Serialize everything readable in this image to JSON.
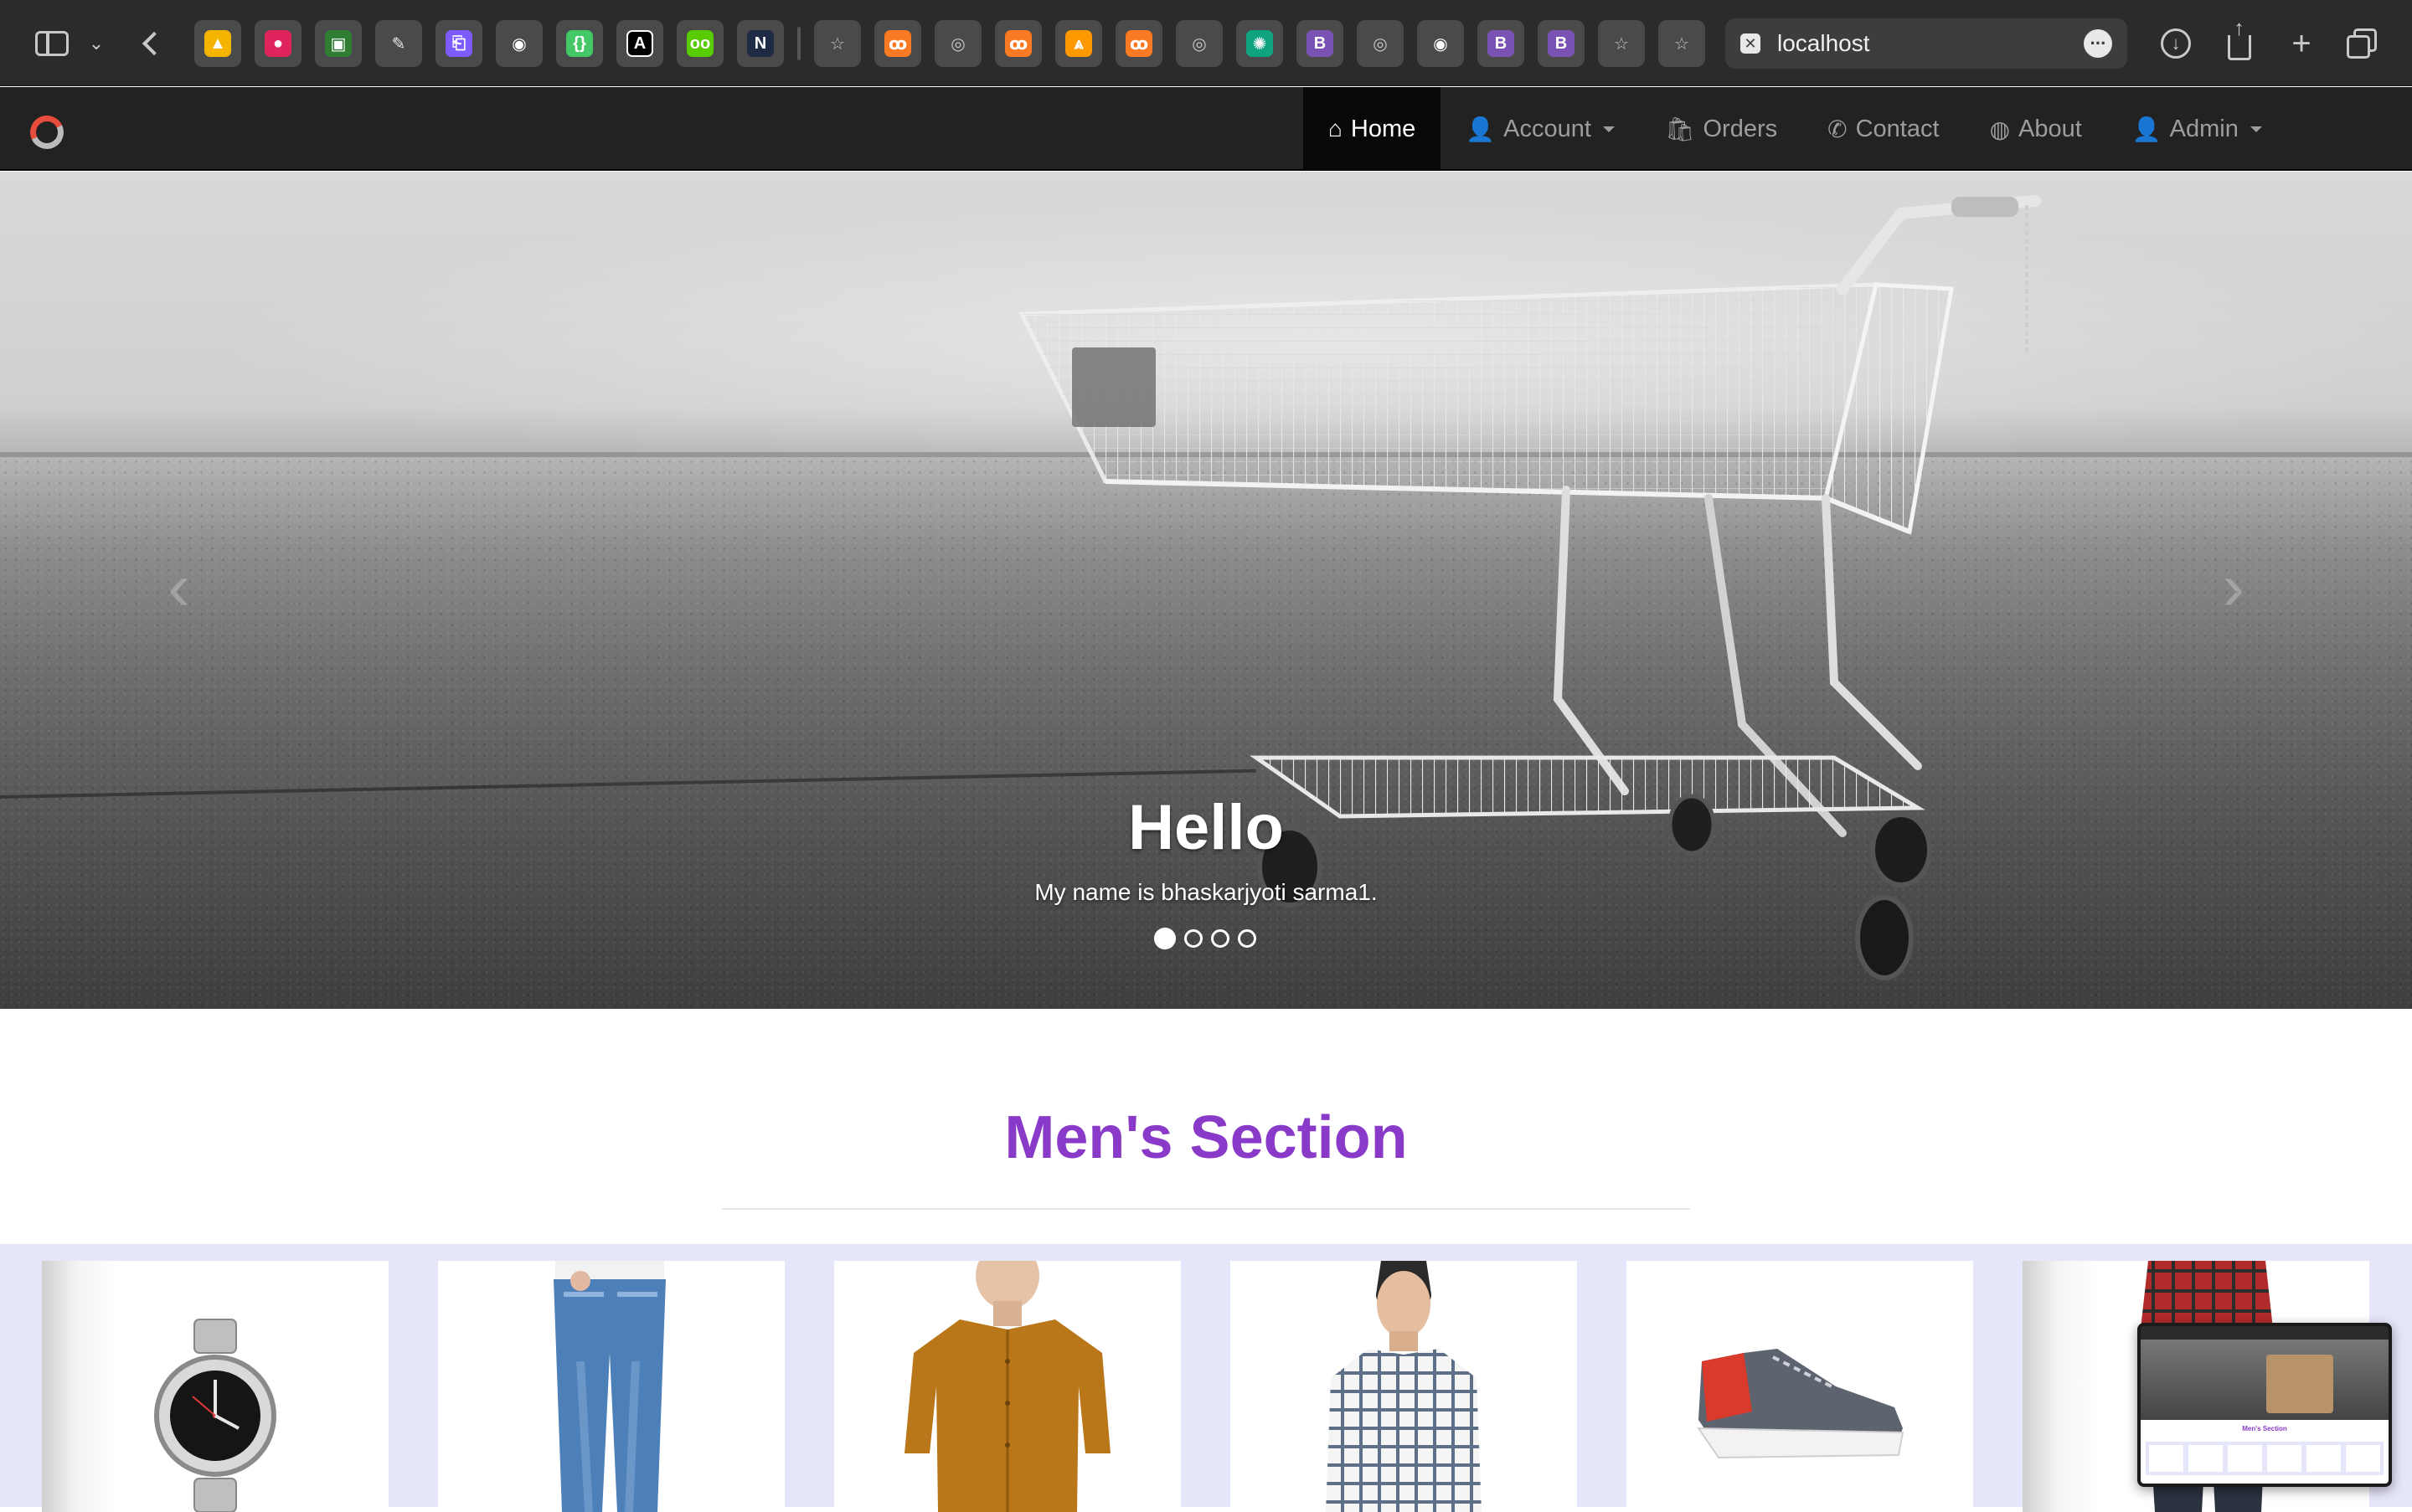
{
  "browser": {
    "url": "localhost",
    "toolbar_icons": [
      "sidebar-icon",
      "chevron-down-icon",
      "back-icon",
      "download-icon",
      "share-icon",
      "new-tab-icon",
      "tab-overview-icon"
    ],
    "favorites": [
      {
        "name": "google-drive",
        "glyph": "▲",
        "color": "#f4b400"
      },
      {
        "name": "red-circle",
        "glyph": "●",
        "color": "#e0245e"
      },
      {
        "name": "google-classroom",
        "glyph": "▣",
        "color": "#2e7d32"
      },
      {
        "name": "quill",
        "glyph": "✎",
        "color": "#e8e8e8"
      },
      {
        "name": "purple-clip",
        "glyph": "⎗",
        "color": "#7c5cff"
      },
      {
        "name": "github",
        "glyph": "◉",
        "color": "#ffffff"
      },
      {
        "name": "green-brackets",
        "glyph": "{}",
        "color": "#44c767"
      },
      {
        "name": "nextjs",
        "glyph": "A",
        "color": "#000000"
      },
      {
        "name": "duolingo",
        "glyph": "oo",
        "color": "#58cc02"
      },
      {
        "name": "notion",
        "glyph": "N",
        "color": "#1f2a44"
      },
      {
        "name": "star-1",
        "glyph": "☆",
        "color": "#c8c8c8"
      },
      {
        "name": "xampp-1",
        "glyph": "ꝏ",
        "color": "#fb7a24"
      },
      {
        "name": "compass-1",
        "glyph": "◎",
        "color": "#c8c8c8"
      },
      {
        "name": "xampp-2",
        "glyph": "ꝏ",
        "color": "#fb7a24"
      },
      {
        "name": "aws",
        "glyph": "⩓",
        "color": "#ff9900"
      },
      {
        "name": "xampp-3",
        "glyph": "ꝏ",
        "color": "#fb7a24"
      },
      {
        "name": "compass-2",
        "glyph": "◎",
        "color": "#c8c8c8"
      },
      {
        "name": "chatgpt",
        "glyph": "✺",
        "color": "#10a37f"
      },
      {
        "name": "bootstrap-1",
        "glyph": "B",
        "color": "#7952b3"
      },
      {
        "name": "compass-3",
        "glyph": "◎",
        "color": "#c8c8c8"
      },
      {
        "name": "github-2",
        "glyph": "◉",
        "color": "#ffffff"
      },
      {
        "name": "bootstrap-2",
        "glyph": "B",
        "color": "#7952b3"
      },
      {
        "name": "bootstrap-3",
        "glyph": "B",
        "color": "#7952b3"
      },
      {
        "name": "star-2",
        "glyph": "☆",
        "color": "#c8c8c8"
      },
      {
        "name": "star-3",
        "glyph": "☆",
        "color": "#c8c8c8"
      }
    ]
  },
  "navbar": {
    "brand_icon": "brand-logo-icon",
    "items": [
      {
        "label": "Home",
        "icon": "⌂",
        "icon_name": "home-icon",
        "active": true,
        "dropdown": false
      },
      {
        "label": "Account",
        "icon": "👤",
        "icon_name": "user-icon",
        "active": false,
        "dropdown": true
      },
      {
        "label": "Orders",
        "icon": "🛍",
        "icon_name": "shopping-bag-icon",
        "active": false,
        "dropdown": false
      },
      {
        "label": "Contact",
        "icon": "✆",
        "icon_name": "phone-icon",
        "active": false,
        "dropdown": false
      },
      {
        "label": "About",
        "icon": "◍",
        "icon_name": "globe-icon",
        "active": false,
        "dropdown": false
      },
      {
        "label": "Admin",
        "icon": "👤",
        "icon_name": "user-icon",
        "active": false,
        "dropdown": true
      }
    ],
    "colors": {
      "background": "#222222",
      "active_background": "#080808",
      "text": "#9d9d9d",
      "active_text": "#ffffff"
    }
  },
  "hero": {
    "title": "Hello",
    "subtitle": "My name is bhaskarjyoti sarma1.",
    "slide_count": 4,
    "active_slide": 0,
    "image": "shopping-cart-on-road-bw"
  },
  "section": {
    "title": "Men's Section",
    "title_color": "#8a3ac8",
    "band_color": "#e6e6fa"
  },
  "products": [
    {
      "name": "wristwatch",
      "image": "watch"
    },
    {
      "name": "blue-jeans",
      "image": "jeans"
    },
    {
      "name": "mustard-shirt",
      "image": "shirt"
    },
    {
      "name": "checked-shirt",
      "image": "checked-shirt"
    },
    {
      "name": "sneaker",
      "image": "shoe"
    },
    {
      "name": "plaid-shirt-jeans",
      "image": "outfit"
    }
  ],
  "preview": {
    "title": "Men's Section"
  }
}
